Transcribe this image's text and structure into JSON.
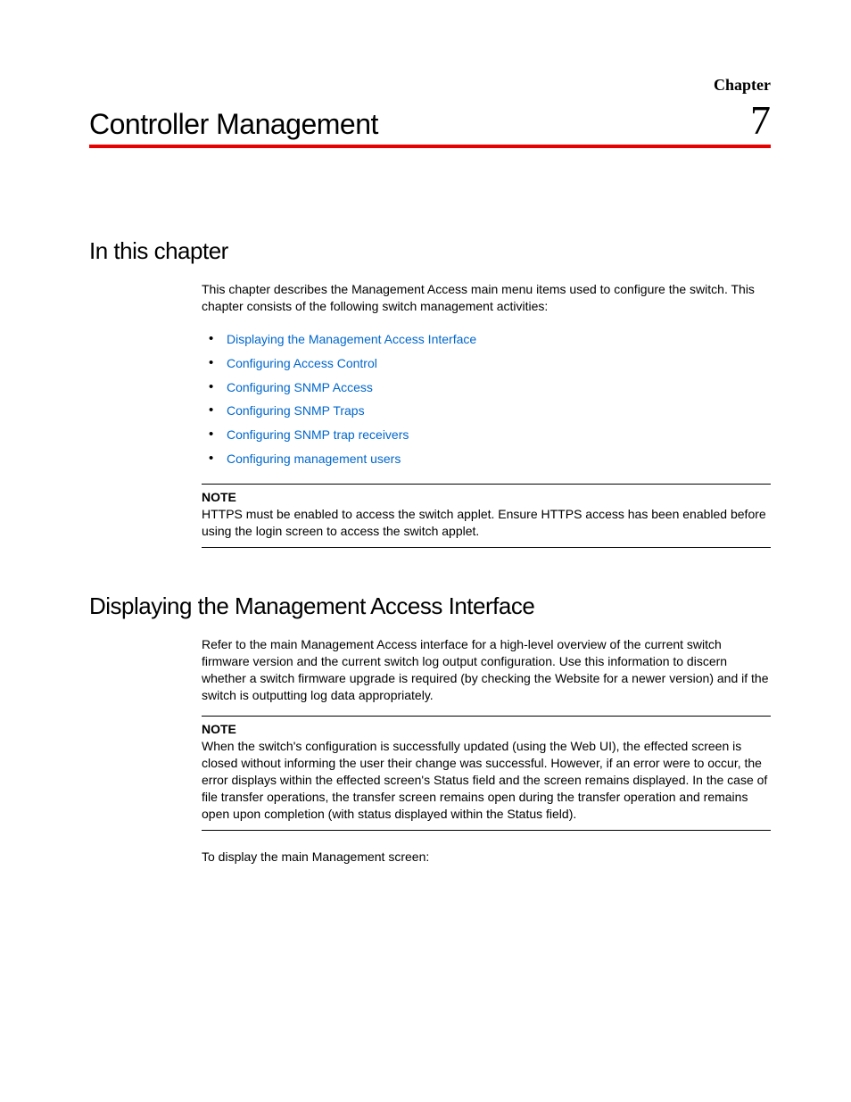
{
  "header": {
    "chapter_label": "Chapter",
    "chapter_title": "Controller Management",
    "chapter_number": "7"
  },
  "section1": {
    "heading": "In this chapter",
    "intro": "This chapter describes the Management Access main menu items used to configure the switch. This chapter consists of the following switch management activities:",
    "links": [
      "Displaying the Management Access Interface",
      "Configuring Access Control",
      "Configuring SNMP Access",
      "Configuring SNMP Traps",
      "Configuring SNMP trap receivers",
      "Configuring management users"
    ],
    "note_label": "NOTE",
    "note_text": "HTTPS must be enabled to access the switch applet. Ensure HTTPS access has been enabled before using the login screen to access the switch applet."
  },
  "section2": {
    "heading": "Displaying the Management Access Interface",
    "para1": "Refer to the main Management Access interface for a high-level overview of the current switch firmware version and the current switch log output configuration. Use this information to discern whether a switch firmware upgrade is required (by checking the Website for a newer version) and if the switch is outputting log data appropriately.",
    "note_label": "NOTE",
    "note_text": "When the switch's configuration is successfully updated (using the Web UI), the effected screen is closed without informing the user their change was successful. However, if an error were to occur, the error displays within the effected screen's Status field and the screen remains displayed. In the case of file transfer operations, the transfer screen remains open during the transfer operation and remains open upon completion (with status displayed within the Status field).",
    "para2": "To display the main Management screen:"
  }
}
